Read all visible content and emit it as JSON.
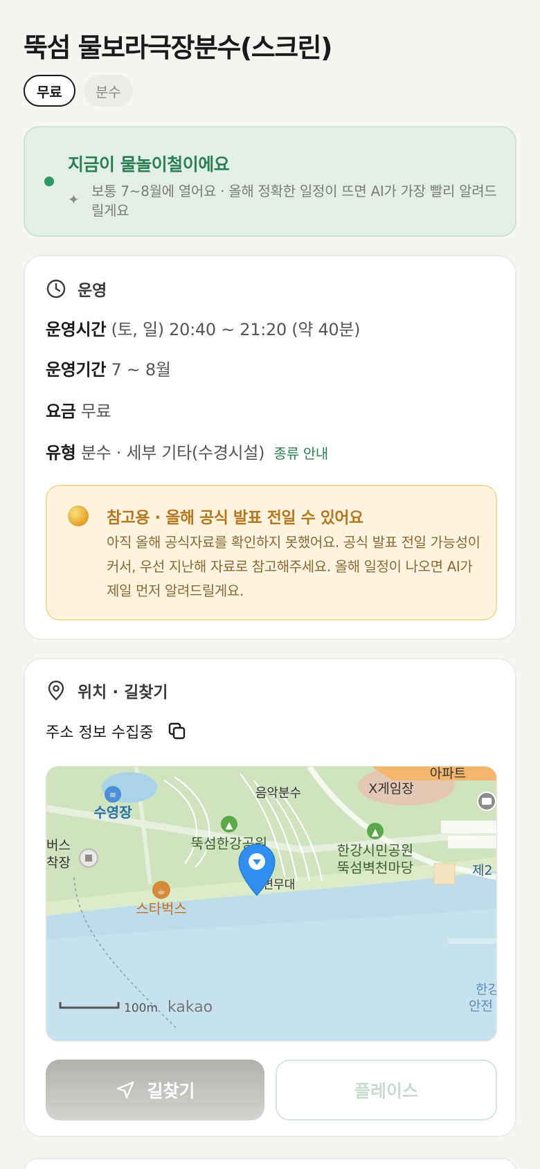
{
  "title": "뚝섬 물보라극장분수(스크린)",
  "tags": [
    "무료",
    "분수"
  ],
  "season_banner": {
    "title": "지금이 물놀이철이에요",
    "text": "보통 7~8월에 열어요 · 올해 정확한 일정이 뜨면 AI가 가장 빨리 알려드릴게요"
  },
  "operation": {
    "section_title": "운영",
    "rows": [
      {
        "label": "운영시간",
        "value": "(토, 일) 20:40 ~ 21:20 (약 40분)"
      },
      {
        "label": "운영기간",
        "value": "7 ~ 8월"
      },
      {
        "label": "요금",
        "value": "무료"
      },
      {
        "label": "유형",
        "value": "분수 · 세부 기타(수경시설)",
        "link": "종류 안내"
      }
    ],
    "notice": {
      "title": "참고용 · 올해 공식 발표 전일 수 있어요",
      "text": "아직 올해 공식자료를 확인하지 못했어요. 공식 발표 전일 가능성이 커서, 우선 지난해 자료로 참고해주세요. 올해 일정이 나오면 AI가 제일 먼저 알려드릴게요."
    }
  },
  "location": {
    "section_title": "위치 · 길찾기",
    "address": "주소 정보 수집중",
    "map": {
      "labels": {
        "pool": "수영장",
        "music_fountain": "음악분수",
        "x_game": "X게임장",
        "apartment": "아파트",
        "ttukseom_park": "뚝섬한강공원",
        "citizen_park_1": "한강시민공원",
        "citizen_park_2": "뚝섬벽천마당",
        "bus_1": "버스",
        "bus_2": "착장",
        "starbucks": "스타벅스",
        "stage": "수변무대",
        "right_edge": "제2",
        "hangang_1": "한강",
        "hangang_2": "안전",
        "scale": "100m",
        "brand": "kakao"
      }
    },
    "route_button": "길찾기",
    "place_button": "플레이스"
  },
  "colors": {
    "accent_green": "#2b7f52",
    "banner_bg": "#e2efe7",
    "notice_bg": "#fff4e0",
    "notice_text": "#b5761c",
    "pin_blue": "#2f8ff0"
  }
}
